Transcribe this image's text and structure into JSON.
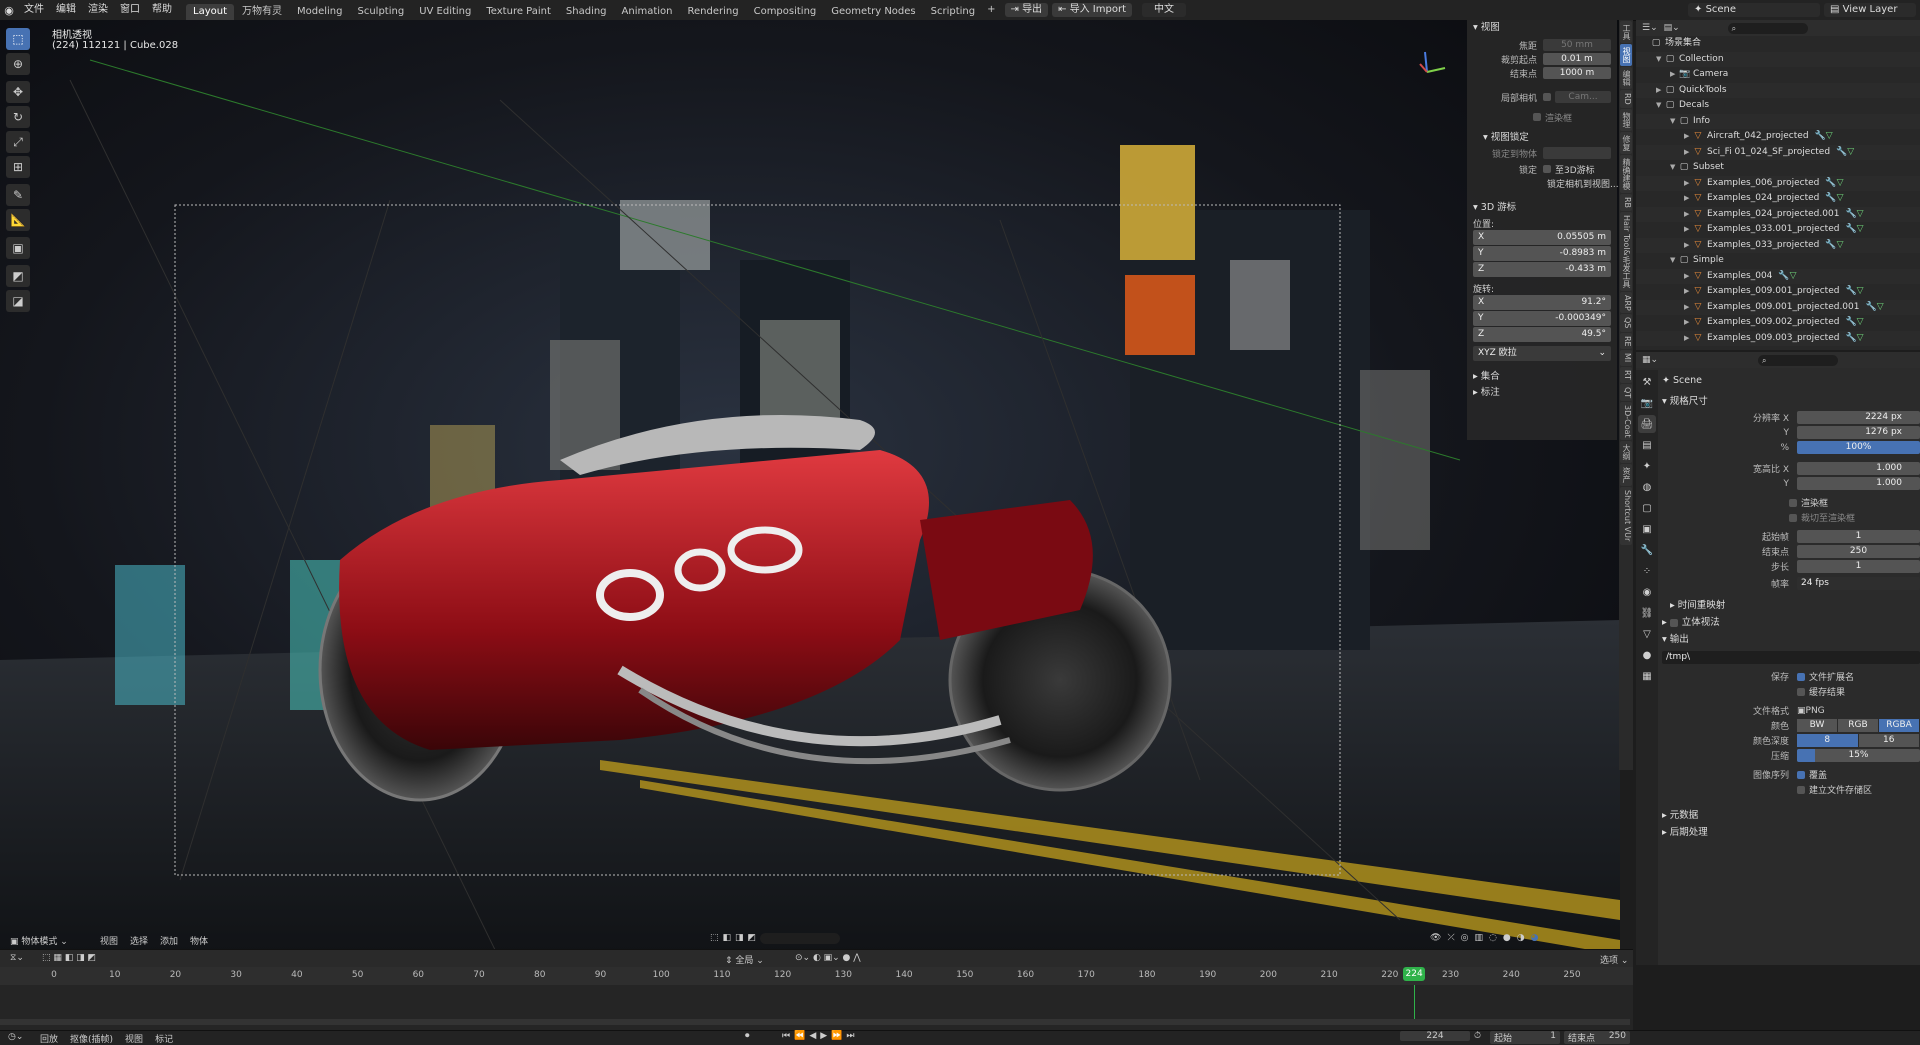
{
  "topbar": {
    "menus": [
      "文件",
      "编辑",
      "渲染",
      "窗口",
      "帮助"
    ],
    "workspaces": [
      "Layout",
      "万物有灵",
      "Modeling",
      "Sculpting",
      "UV Editing",
      "Texture Paint",
      "Shading",
      "Animation",
      "Rendering",
      "Compositing",
      "Geometry Nodes",
      "Scripting"
    ],
    "active_workspace": "Layout",
    "export_label": "导出",
    "import_label": "导入 Import",
    "lang_label": "中文",
    "scene_name": "Scene",
    "view_layer": "View Layer"
  },
  "viewport": {
    "view_name": "相机透视",
    "info_line": "(224) 112121 | Cube.028",
    "mode": "物体模式",
    "header_menus": [
      "视图",
      "选择",
      "添加",
      "物体"
    ],
    "transform_orientation": "全局"
  },
  "npanel": {
    "view_header": "视图",
    "focal_label": "焦距",
    "focal_value": "50 mm",
    "clip_start_label": "裁剪起点",
    "clip_start_value": "0.01 m",
    "clip_end_label": "结束点",
    "clip_end_value": "1000 m",
    "local_camera_label": "局部相机",
    "local_camera_value": "Cam...",
    "render_region_label": "渲染框",
    "view_lock_header": "视图锁定",
    "lock_to_object_label": "锁定到物体",
    "lock_label": "锁定",
    "lock_cursor_label": "至3D游标",
    "lock_camera_label": "锁定相机到视图...",
    "cursor_header": "3D 游标",
    "location_label": "位置:",
    "loc": [
      {
        "axis": "X",
        "value": "0.05505 m"
      },
      {
        "axis": "Y",
        "value": "-0.8983 m"
      },
      {
        "axis": "Z",
        "value": "-0.433 m"
      }
    ],
    "rotation_label": "旋转:",
    "rot": [
      {
        "axis": "X",
        "value": "91.2°"
      },
      {
        "axis": "Y",
        "value": "-0.000349°"
      },
      {
        "axis": "Z",
        "value": "49.5°"
      }
    ],
    "rotation_mode": "XYZ 欧拉",
    "collection_header": "集合",
    "annotation_header": "标注"
  },
  "vtabs": [
    "工具",
    "视图",
    "编辑",
    "RD",
    "物理",
    "修复",
    "精确建模",
    "RB",
    "Hair Tool&毛发工具",
    "ARP",
    "QS",
    "RE",
    "MI",
    "RT",
    "QT",
    "3D-Coat",
    "大纲",
    "资产",
    "Shortcut VUr"
  ],
  "outliner": {
    "rows": [
      {
        "indent": 0,
        "label": "场景集合",
        "icon": "collection-icon",
        "tri": ""
      },
      {
        "indent": 1,
        "label": "Collection",
        "icon": "collection-icon",
        "tri": "▼"
      },
      {
        "indent": 2,
        "label": "Camera",
        "icon": "camera-icon",
        "tri": "▶"
      },
      {
        "indent": 1,
        "label": "QuickTools",
        "icon": "collection-icon",
        "tri": "▶"
      },
      {
        "indent": 1,
        "label": "Decals",
        "icon": "collection-icon",
        "tri": "▼"
      },
      {
        "indent": 2,
        "label": "Info",
        "icon": "collection-icon",
        "tri": "▼"
      },
      {
        "indent": 3,
        "label": "Aircraft_042_projected",
        "icon": "mesh-icon",
        "tri": "▶"
      },
      {
        "indent": 3,
        "label": "Sci_Fi 01_024_SF_projected",
        "icon": "mesh-icon",
        "tri": "▶"
      },
      {
        "indent": 2,
        "label": "Subset",
        "icon": "collection-icon",
        "tri": "▼"
      },
      {
        "indent": 3,
        "label": "Examples_006_projected",
        "icon": "mesh-icon",
        "tri": "▶"
      },
      {
        "indent": 3,
        "label": "Examples_024_projected",
        "icon": "mesh-icon",
        "tri": "▶"
      },
      {
        "indent": 3,
        "label": "Examples_024_projected.001",
        "icon": "mesh-icon",
        "tri": "▶"
      },
      {
        "indent": 3,
        "label": "Examples_033.001_projected",
        "icon": "mesh-icon",
        "tri": "▶"
      },
      {
        "indent": 3,
        "label": "Examples_033_projected",
        "icon": "mesh-icon",
        "tri": "▶"
      },
      {
        "indent": 2,
        "label": "Simple",
        "icon": "collection-icon",
        "tri": "▼"
      },
      {
        "indent": 3,
        "label": "Examples_004",
        "icon": "mesh-icon",
        "tri": "▶"
      },
      {
        "indent": 3,
        "label": "Examples_009.001_projected",
        "icon": "mesh-icon",
        "tri": "▶"
      },
      {
        "indent": 3,
        "label": "Examples_009.001_projected.001",
        "icon": "mesh-icon",
        "tri": "▶"
      },
      {
        "indent": 3,
        "label": "Examples_009.002_projected",
        "icon": "mesh-icon",
        "tri": "▶"
      },
      {
        "indent": 3,
        "label": "Examples_009.003_projected",
        "icon": "mesh-icon",
        "tri": "▶"
      }
    ]
  },
  "props": {
    "scene_label": "Scene",
    "format_header": "规格尺寸",
    "res_x_label": "分辨率 X",
    "res_x": "2224 px",
    "res_y_label": "Y",
    "res_y": "1276 px",
    "res_pct_label": "%",
    "res_pct": "100%",
    "aspect_x_label": "宽高比 X",
    "aspect_x": "1.000",
    "aspect_y_label": "Y",
    "aspect_y": "1.000",
    "render_region": "渲染框",
    "crop_region": "裁切至渲染框",
    "frame_start_label": "起始帧",
    "frame_start": "1",
    "frame_end_label": "结束点",
    "frame_end": "250",
    "frame_step_label": "步长",
    "frame_step": "1",
    "fps_label": "帧率",
    "fps": "24 fps",
    "time_remap": "时间重映射",
    "stereo": "立体视法",
    "output_header": "输出",
    "output_path": "/tmp\\",
    "save_label": "保存",
    "file_ext": "文件扩展名",
    "cache_result": "缓存结果",
    "file_format_label": "文件格式",
    "file_format": "PNG",
    "color_label": "颜色",
    "color_options": [
      "BW",
      "RGB",
      "RGBA"
    ],
    "color_selected": "RGBA",
    "depth_label": "颜色深度",
    "depth_options": [
      "8",
      "16"
    ],
    "compress_label": "压缩",
    "compress": "15%",
    "compress_frac": 0.15,
    "image_seq_label": "图像序列",
    "overwrite": "覆盖",
    "placeholders": "建立文件存储区",
    "metadata": "元数据",
    "post": "后期处理"
  },
  "timeline": {
    "menus": [
      "回放",
      "抠像(插帧)",
      "视图",
      "标记"
    ],
    "current_frame": "224",
    "start_label": "起始",
    "start": "1",
    "end_label": "结束点",
    "end": "250",
    "ticks": [
      "0",
      "10",
      "20",
      "30",
      "40",
      "50",
      "60",
      "70",
      "80",
      "90",
      "100",
      "110",
      "120",
      "130",
      "140",
      "150",
      "160",
      "170",
      "180",
      "190",
      "200",
      "210",
      "220",
      "230",
      "240",
      "250"
    ],
    "frame_min": 0,
    "frame_max": 250,
    "snap_label": "选项"
  },
  "colors": {
    "accent": "#4772b3",
    "playhead": "#2fb24a",
    "bike_red": "#b3121b"
  }
}
